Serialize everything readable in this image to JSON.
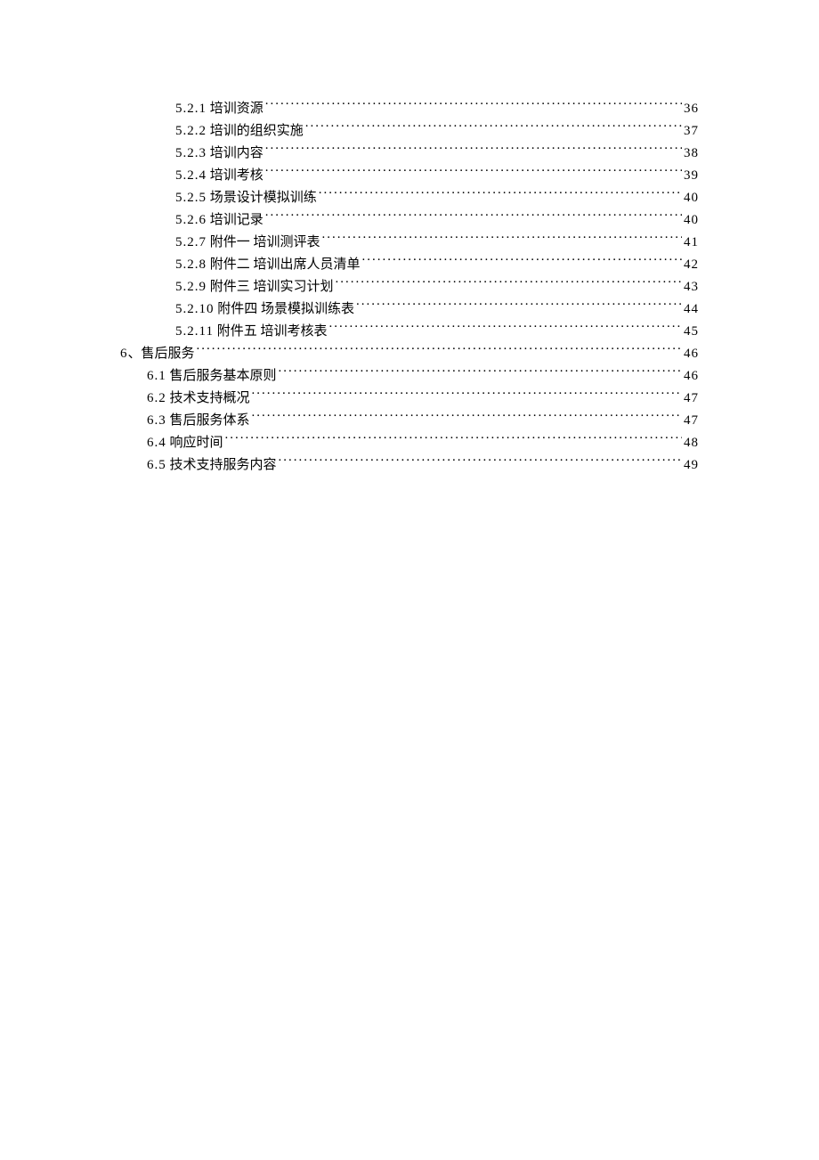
{
  "toc": [
    {
      "indent": 2,
      "num": "5.2.1",
      "title": "培训资源",
      "page": "36"
    },
    {
      "indent": 2,
      "num": "5.2.2",
      "title": "培训的组织实施",
      "page": "37"
    },
    {
      "indent": 2,
      "num": "5.2.3",
      "title": "培训内容",
      "page": "38"
    },
    {
      "indent": 2,
      "num": "5.2.4",
      "title": "培训考核",
      "page": "39"
    },
    {
      "indent": 2,
      "num": "5.2.5",
      "title": "场景设计模拟训练",
      "page": "40"
    },
    {
      "indent": 2,
      "num": "5.2.6",
      "title": "培训记录",
      "page": "40"
    },
    {
      "indent": 2,
      "num": "5.2.7",
      "title": "附件一 培训测评表",
      "page": "41"
    },
    {
      "indent": 2,
      "num": "5.2.8",
      "title": "附件二 培训出席人员清单",
      "page": "42"
    },
    {
      "indent": 2,
      "num": "5.2.9",
      "title": "附件三 培训实习计划",
      "page": "43"
    },
    {
      "indent": 2,
      "num": "5.2.10",
      "title": "附件四 场景模拟训练表",
      "page": "44"
    },
    {
      "indent": 2,
      "num": "5.2.11",
      "title": "附件五 培训考核表",
      "page": "45"
    },
    {
      "indent": 0,
      "num": "6",
      "sep": "、",
      "title": "售后服务",
      "page": "46"
    },
    {
      "indent": 1,
      "num": "6.1",
      "title": "售后服务基本原则",
      "page": "46"
    },
    {
      "indent": 1,
      "num": "6.2",
      "title": "技术支持概况",
      "page": "47"
    },
    {
      "indent": 1,
      "num": "6.3",
      "title": "售后服务体系",
      "page": "47"
    },
    {
      "indent": 1,
      "num": "6.4",
      "title": "响应时间",
      "page": "48"
    },
    {
      "indent": 1,
      "num": "6.5",
      "title": "技术支持服务内容",
      "page": "49"
    }
  ]
}
